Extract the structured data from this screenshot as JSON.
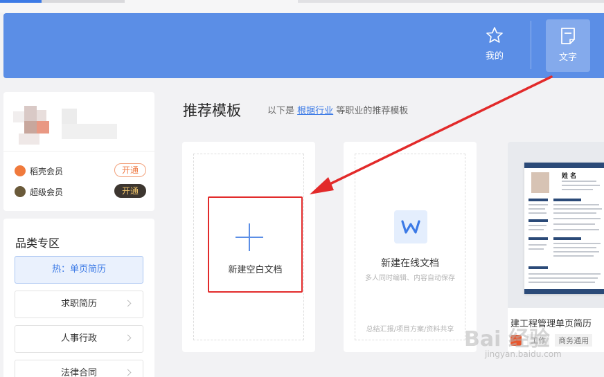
{
  "header": {
    "mine_label": "我的",
    "text_label": "文字"
  },
  "user": {
    "memberships": [
      {
        "label": "稻壳会员",
        "button": "开通"
      },
      {
        "label": "超级会员",
        "button": "开通"
      }
    ]
  },
  "categories": {
    "title": "品类专区",
    "items": [
      {
        "label": "热：单页简历"
      },
      {
        "label": "求职简历"
      },
      {
        "label": "人事行政"
      },
      {
        "label": "法律合同"
      }
    ]
  },
  "recommend": {
    "title": "推荐模板",
    "sub_prefix": "以下是",
    "sub_link": "根据行业",
    "sub_suffix": "等职业的推荐模板"
  },
  "templates": {
    "blank_label": "新建空白文档",
    "online_title": "新建在线文档",
    "online_sub": "多人同时编辑、内容自动保存",
    "online_foot": "总结汇报/项目方案/资料共享",
    "resume_name": "姓 名",
    "resume_title": "建工程管理单页简历",
    "resume_tags": [
      "工作",
      "商务通用"
    ]
  },
  "watermark": {
    "main": "Bai 经验",
    "url": "jingyan.baidu.com"
  },
  "colors": {
    "banner": "#5b8ee6",
    "accent": "#3c7ae6",
    "highlight_box": "#e22a2a"
  }
}
